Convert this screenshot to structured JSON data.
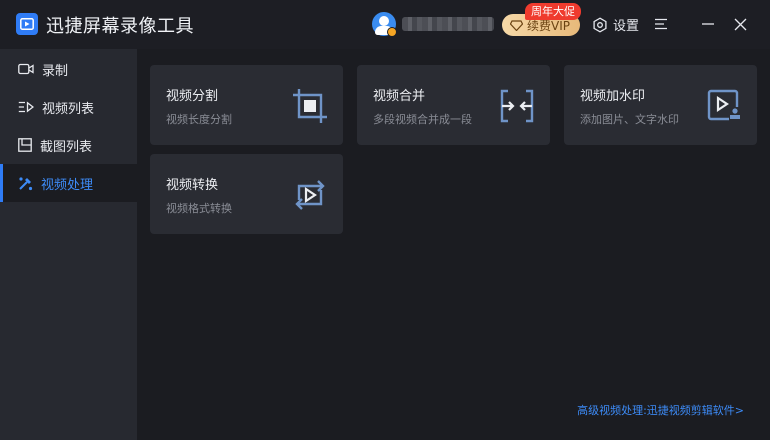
{
  "app": {
    "title": "迅捷屏幕录像工具"
  },
  "header": {
    "vip_label": "续费VIP",
    "vip_badge": "周年大促",
    "settings_label": "设置"
  },
  "sidebar": {
    "items": [
      {
        "label": "录制",
        "icon": "camera-icon"
      },
      {
        "label": "视频列表",
        "icon": "video-list-icon"
      },
      {
        "label": "截图列表",
        "icon": "screenshot-list-icon"
      },
      {
        "label": "视频处理",
        "icon": "video-process-icon",
        "active": true
      }
    ]
  },
  "cards": [
    {
      "title": "视频分割",
      "desc": "视频长度分割",
      "icon": "crop-icon"
    },
    {
      "title": "视频合并",
      "desc": "多段视频合并成一段",
      "icon": "merge-icon"
    },
    {
      "title": "视频加水印",
      "desc": "添加图片、文字水印",
      "icon": "watermark-icon"
    },
    {
      "title": "视频转换",
      "desc": "视频格式转换",
      "icon": "convert-icon"
    }
  ],
  "footer": {
    "link": "高级视频处理:迅捷视频剪辑软件>"
  },
  "colors": {
    "accent": "#2f7cf6",
    "icon": "#6f94c8"
  }
}
